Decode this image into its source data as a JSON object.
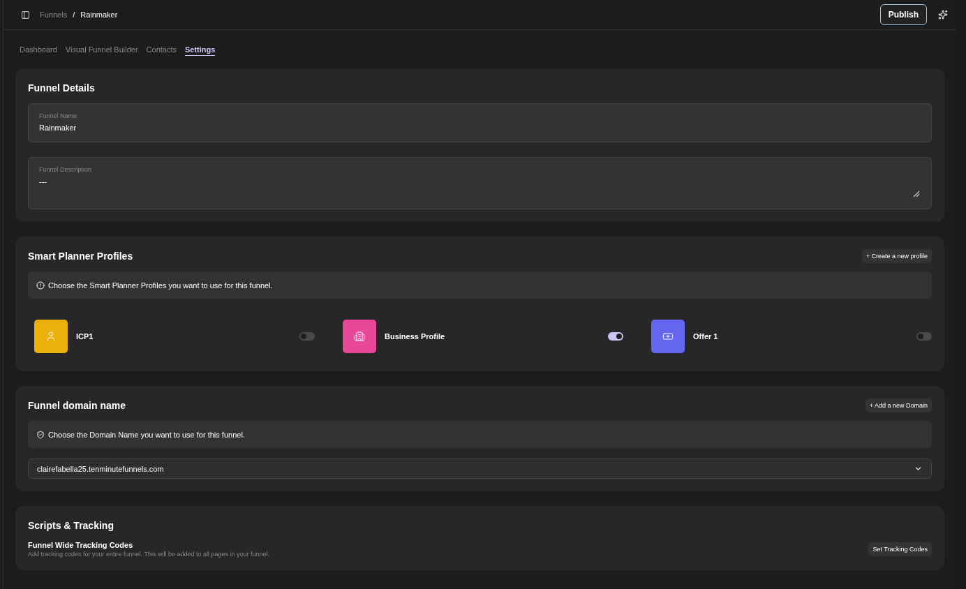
{
  "breadcrumb": {
    "parent": "Funnels",
    "separator": "/",
    "current": "Rainmaker"
  },
  "publish_button": "Publish",
  "tabs": [
    {
      "label": "Dashboard",
      "selected": false
    },
    {
      "label": "Visual Funnel Builder",
      "selected": false
    },
    {
      "label": "Contacts",
      "selected": false
    },
    {
      "label": "Settings",
      "selected": true
    }
  ],
  "funnel_details": {
    "title": "Funnel Details",
    "name_field": {
      "label": "Funnel Name",
      "value": "Rainmaker"
    },
    "description_field": {
      "label": "Funnel Description",
      "value": "---"
    }
  },
  "smart_planner": {
    "title": "Smart Planner Profiles",
    "action": "+ Create a new profile",
    "notice": "Choose the Smart Planner Profiles you want to use for this funnel.",
    "profiles": [
      {
        "name": "ICP1",
        "kind": "person",
        "color": "#e9b10a",
        "on": false
      },
      {
        "name": "Business Profile",
        "kind": "building",
        "color": "#e8479a",
        "on": true
      },
      {
        "name": "Offer 1",
        "kind": "money",
        "color": "#6566f0",
        "on": false
      }
    ]
  },
  "domain": {
    "title": "Funnel domain name",
    "action": "+ Add a new Domain",
    "notice": "Choose the Domain Name you want to use for this funnel.",
    "selected_domain": "clairefabella25.tenminutefunnels.com"
  },
  "scripts": {
    "title": "Scripts & Tracking",
    "item_title": "Funnel Wide Tracking Codes",
    "item_description": "Add tracking codes for your entire funnel. This will be added to all pages in your funnel.",
    "action": "Set Tracking Codes"
  }
}
